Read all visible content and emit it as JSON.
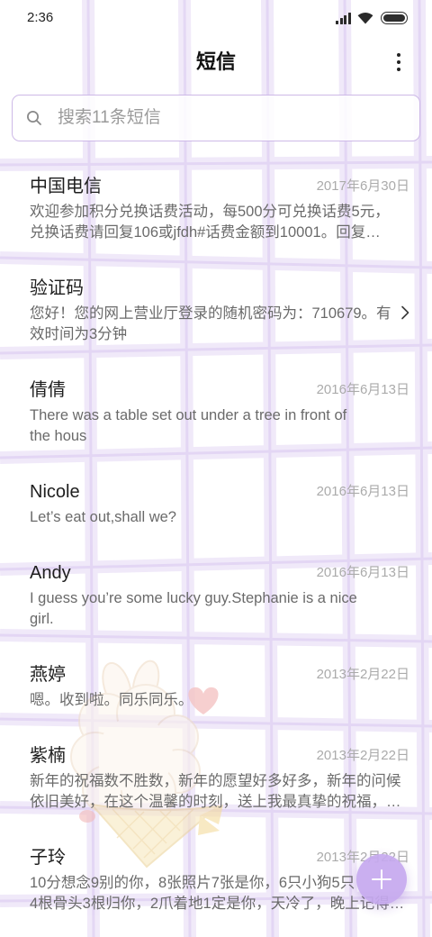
{
  "status_bar": {
    "time": "2:36",
    "signal_icon": "signal-icon",
    "wifi_icon": "wifi-icon",
    "battery_icon": "battery-icon",
    "signal_bars": 4,
    "battery_percent": 100
  },
  "header": {
    "title": "短信",
    "menu_icon": "more-vertical-icon"
  },
  "search": {
    "icon": "search-icon",
    "placeholder": "搜索11条短信"
  },
  "conversations": [
    {
      "name": "中国电信",
      "date": "2017年6月30日",
      "lines": [
        "欢迎参加积分兑换话费活动，每500分可兑换话费5元，",
        "兑换话费请回复106或jfdh#话费金额到10001。回复…"
      ]
    },
    {
      "name": "验证码",
      "trailing_icon": "chevron-right-icon",
      "lines": [
        "您好！您的网上营业厅登录的随机密码为：710679。有",
        "效时间为3分钟"
      ]
    },
    {
      "name": "倩倩",
      "date": "2016年6月13日",
      "lines": [
        "There was a table set out under a tree in front of",
        "the hous"
      ]
    },
    {
      "name": "Nicole",
      "date": "2016年6月13日",
      "lines": [
        "Let’s eat out,shall we?"
      ]
    },
    {
      "name": "Andy",
      "date": "2016年6月13日",
      "lines": [
        "I guess you’re some lucky guy.Stephanie is a nice",
        "girl."
      ]
    },
    {
      "name": "燕婷",
      "date": "2013年2月22日",
      "lines": [
        "嗯。收到啦。同乐同乐。"
      ]
    },
    {
      "name": "紫楠",
      "date": "2013年2月22日",
      "lines": [
        "新年的祝福数不胜数，新年的愿望好多好多，新年的问候",
        "依旧美好，在这个温馨的时刻，送上我最真挚的祝福，…"
      ]
    },
    {
      "name": "子玲",
      "date": "2013年2月22日",
      "lines": [
        "10分想念9别的你，8张照片7张是你，6只小狗5只",
        "4根骨头3根归你，2爪着地1定是你，天冷了，晚上记得…"
      ]
    }
  ],
  "fab": {
    "icon": "plus-icon"
  },
  "colors": {
    "accent": "#c6a9ef",
    "name_text": "#1e1e1e",
    "preview_text": "#6a6a6a",
    "date_text": "#ababab",
    "grid": "#d9c8f0"
  }
}
